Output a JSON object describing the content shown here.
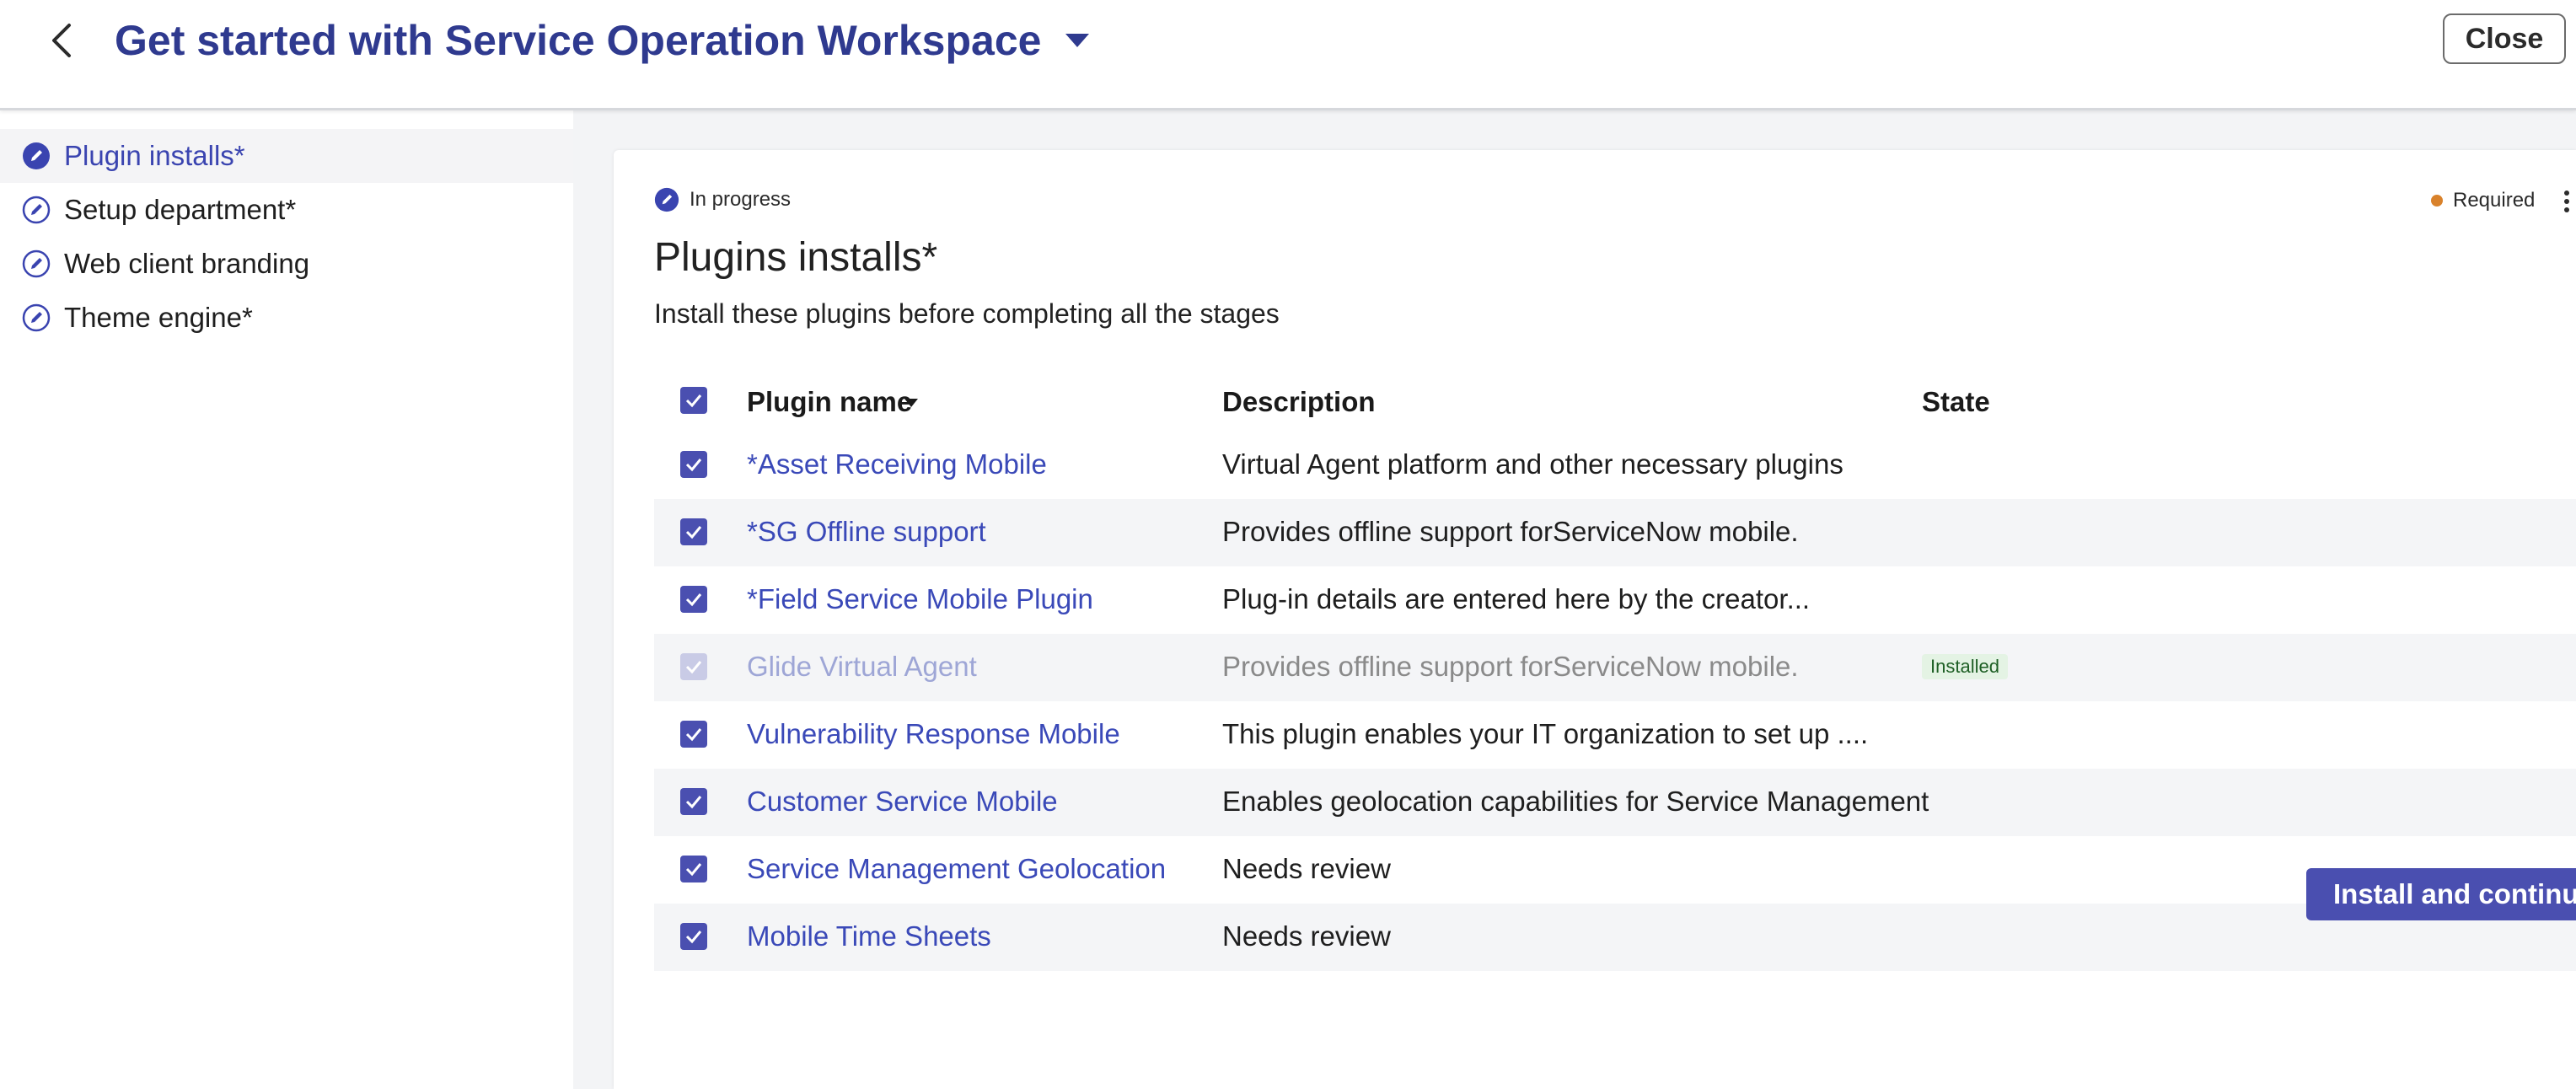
{
  "header": {
    "title": "Get started with Service Operation Workspace",
    "close_label": "Close"
  },
  "sidebar": {
    "items": [
      {
        "label": "Plugin installs*",
        "active": true
      },
      {
        "label": "Setup department*",
        "active": false
      },
      {
        "label": "Web client branding",
        "active": false
      },
      {
        "label": "Theme engine*",
        "active": false
      }
    ]
  },
  "card": {
    "status": "In progress",
    "required_label": "Required",
    "title": "Plugins installs*",
    "subtitle": "Install these plugins before completing all the stages"
  },
  "table": {
    "columns": {
      "name": "Plugin name",
      "description": "Description",
      "state": "State"
    },
    "rows": [
      {
        "name": "*Asset Receiving Mobile",
        "description": "Virtual Agent platform and other necessary plugins",
        "state": "",
        "checked": true,
        "disabled": false
      },
      {
        "name": "*SG Offline support",
        "description": "Provides offline support forServiceNow mobile.",
        "state": "",
        "checked": true,
        "disabled": false
      },
      {
        "name": "*Field Service Mobile Plugin",
        "description": "Plug-in details are entered here by the creator...",
        "state": "",
        "checked": true,
        "disabled": false
      },
      {
        "name": "Glide Virtual Agent",
        "description": "Provides offline support forServiceNow mobile.",
        "state": "Installed",
        "checked": true,
        "disabled": true
      },
      {
        "name": "Vulnerability Response Mobile",
        "description": "This plugin enables your IT organization to set up ....",
        "state": "",
        "checked": true,
        "disabled": false
      },
      {
        "name": "Customer Service Mobile",
        "description": "Enables geolocation capabilities for Service Management",
        "state": "",
        "checked": true,
        "disabled": false
      },
      {
        "name": "Service Management Geolocation",
        "description": "Needs review",
        "state": "",
        "checked": true,
        "disabled": false
      },
      {
        "name": "Mobile Time Sheets",
        "description": "Needs review",
        "state": "",
        "checked": true,
        "disabled": false
      }
    ]
  },
  "actions": {
    "primary_label": "Install and continue"
  },
  "colors": {
    "accent": "#4a4fb0",
    "title": "#2f3a8f",
    "link": "#3a49b8",
    "required_dot": "#d9822b",
    "installed_badge_bg": "#e4f3e4"
  }
}
